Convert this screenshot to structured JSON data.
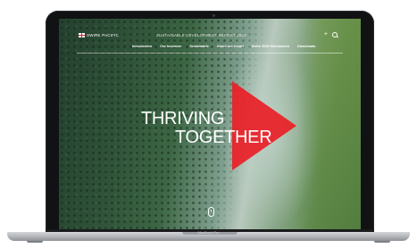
{
  "device": {
    "model_label": "MacBook Pro"
  },
  "site": {
    "brand": "SWIRE PACIFIC",
    "report_title": "SUSTAINABLE DEVELOPMENT REPORT 2020",
    "nav": [
      "Introduction",
      "Our business",
      "Sustainable",
      "About our report",
      "Swire 2020 Disclosures",
      "Downloads"
    ],
    "hero": {
      "line1": "THRIVING",
      "line2": "TOGETHER"
    },
    "icons": {
      "menu": "plus-icon",
      "search": "search-icon",
      "scroll": "scroll-down-icon",
      "flag": "flag-icon"
    }
  },
  "colors": {
    "accent": "#EB1C24",
    "text": "#FFFFFF"
  }
}
